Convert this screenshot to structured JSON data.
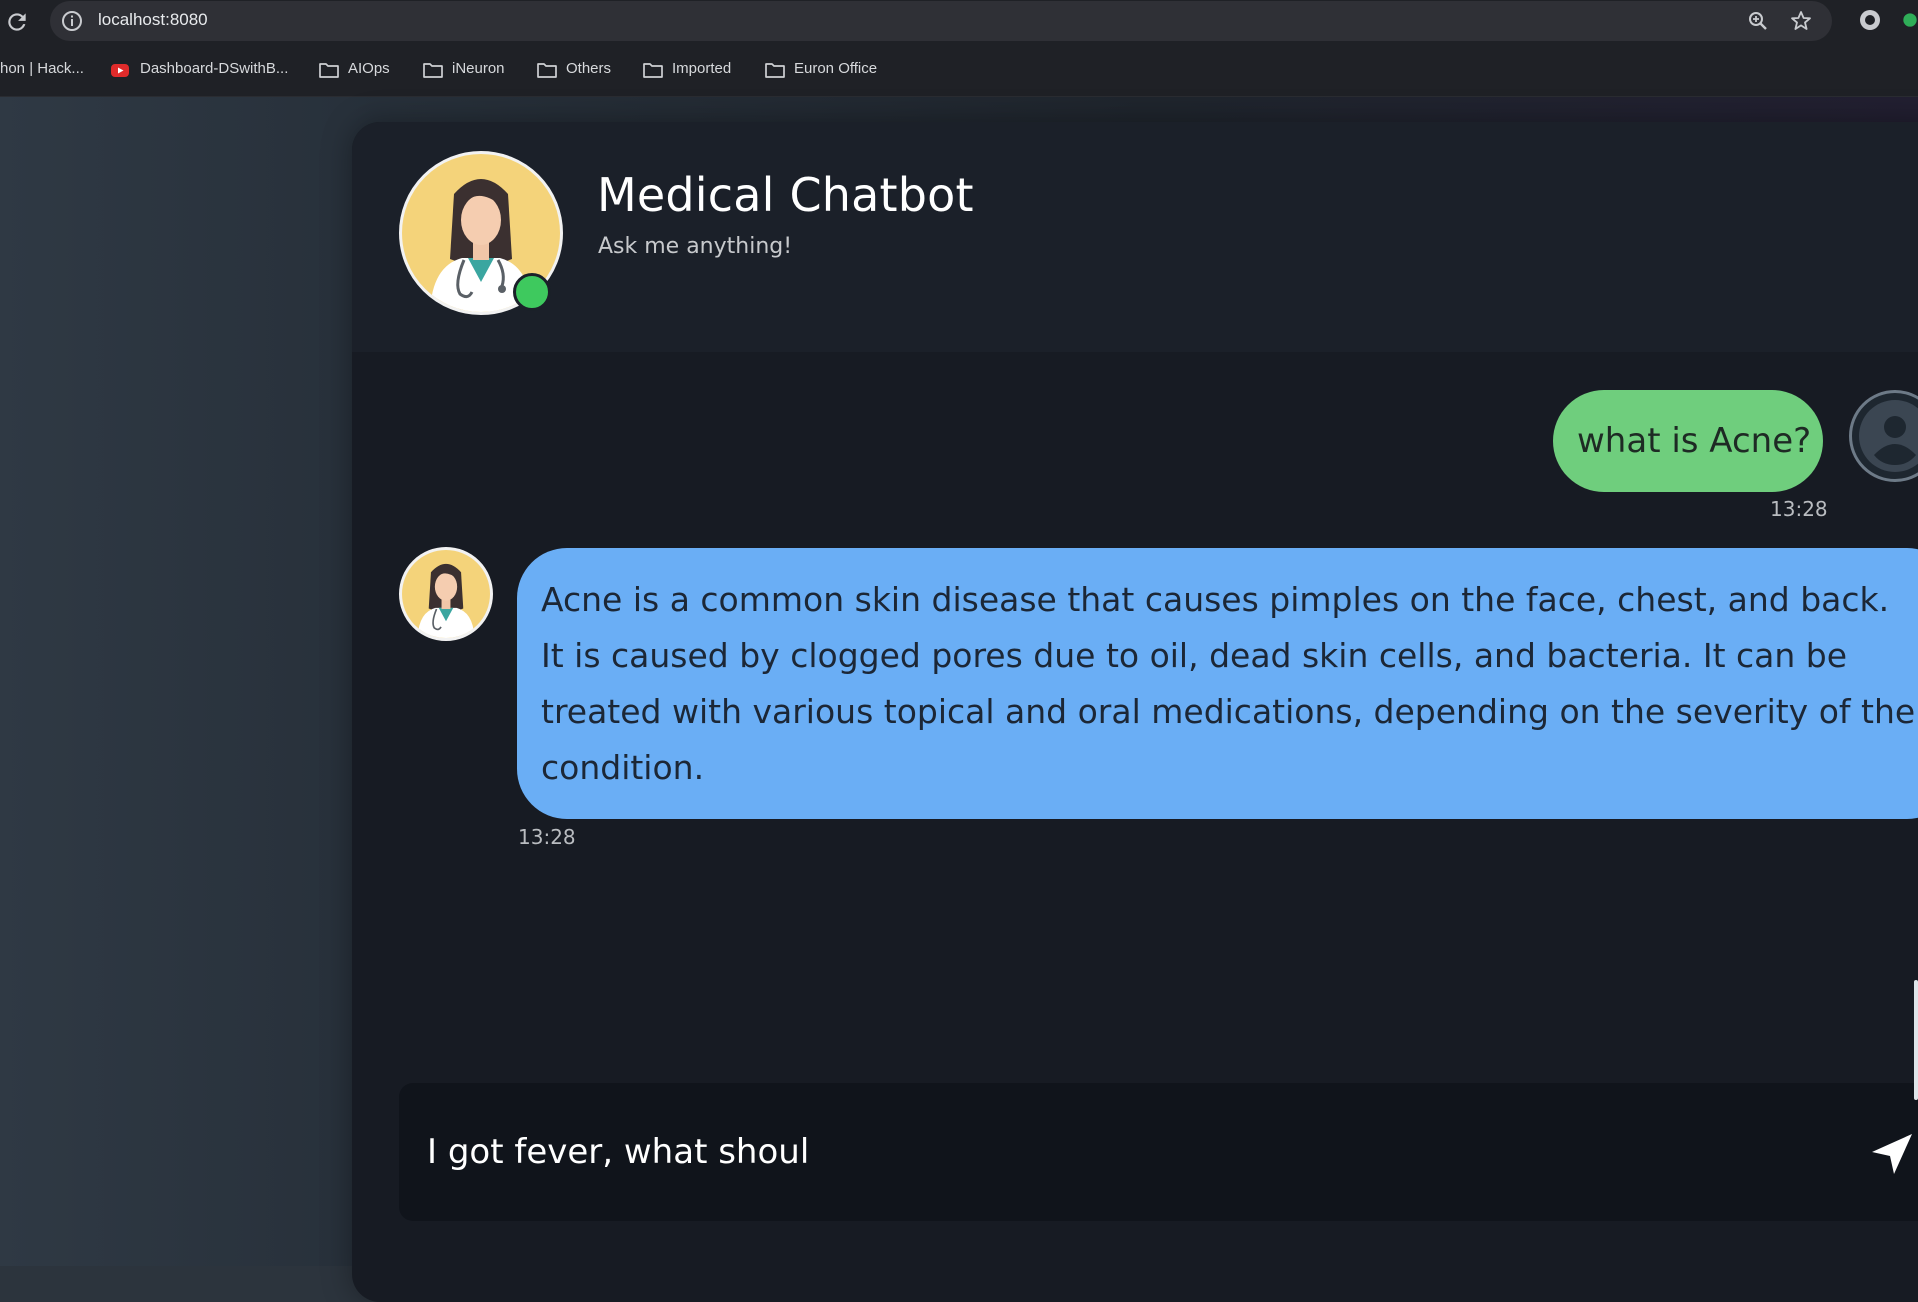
{
  "browser": {
    "url": "localhost:8080",
    "bookmarks": [
      {
        "label": "hon | Hack...",
        "icon": "none"
      },
      {
        "label": "Dashboard-DSwithB...",
        "icon": "youtube-icon"
      },
      {
        "label": "AIOps",
        "icon": "folder-icon"
      },
      {
        "label": "iNeuron",
        "icon": "folder-icon"
      },
      {
        "label": "Others",
        "icon": "folder-icon"
      },
      {
        "label": "Imported",
        "icon": "folder-icon"
      },
      {
        "label": "Euron Office",
        "icon": "folder-icon"
      }
    ]
  },
  "header": {
    "title": "Medical Chatbot",
    "subtitle": "Ask me anything!",
    "status": "online",
    "status_color": "#3ec95e"
  },
  "messages": [
    {
      "role": "user",
      "text": "what is Acne?",
      "time": "13:28",
      "color": "#6fce7d"
    },
    {
      "role": "bot",
      "text": "Acne is a common skin disease that causes pimples on the face, chest, and back. It is caused by clogged pores due to oil, dead skin cells, and bacteria. It can be treated with various topical and oral medications, depending on the severity of the condition.",
      "time": "13:28",
      "color": "#6aaef5"
    }
  ],
  "input": {
    "value": "I got fever, what shoul"
  }
}
